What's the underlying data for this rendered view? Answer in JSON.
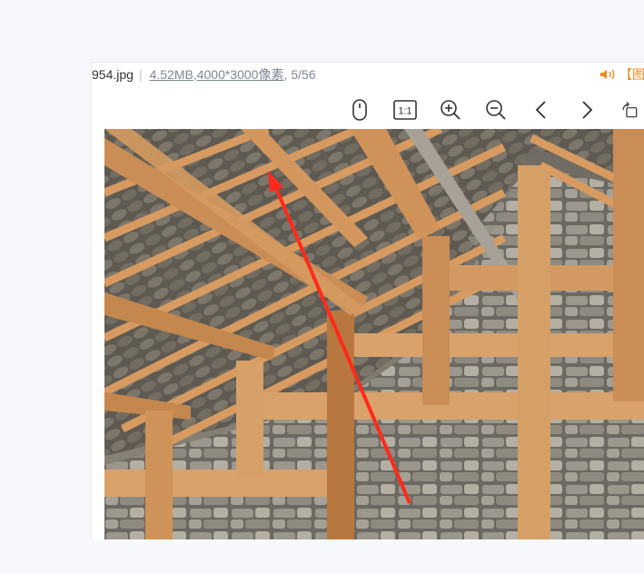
{
  "file": {
    "name": "954.jpg",
    "separator": "|",
    "size": "4.52MB",
    "comma1": ",",
    "dimensions": "4000*3000像素",
    "comma2": ",",
    "position": "5/56"
  },
  "notice": {
    "text": "【图"
  },
  "toolbar": {
    "actual_size_label": "1:1",
    "buttons": [
      "mouse-mode-icon",
      "actual-size-button",
      "zoom-in-icon",
      "zoom-out-icon",
      "previous-icon",
      "next-icon",
      "rotate-icon"
    ]
  },
  "photo": {
    "subject": "timber roof truss and stone wall",
    "annotation": "red arrow"
  },
  "colors": {
    "accent": "#f08a1c",
    "link": "#7d8796",
    "arrow": "#ff2a1a",
    "timber": "#d9a26a",
    "stone": "#8a8a82"
  }
}
